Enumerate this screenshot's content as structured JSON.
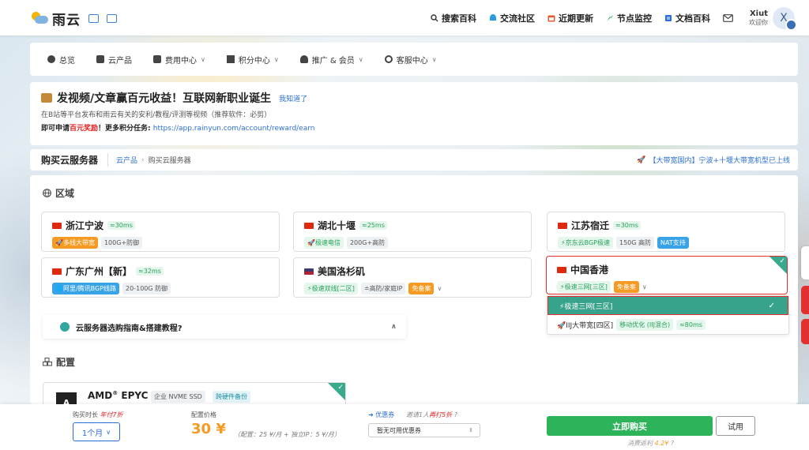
{
  "brand": {
    "name": "雨云"
  },
  "topnav": {
    "items": [
      {
        "label": "搜索百科",
        "icon": "search-icon"
      },
      {
        "label": "交流社区",
        "icon": "community-icon"
      },
      {
        "label": "近期更新",
        "icon": "calendar-icon"
      },
      {
        "label": "节点监控",
        "icon": "monitor-icon"
      },
      {
        "label": "文档百科",
        "icon": "docs-icon"
      }
    ],
    "mail_icon": "mail-icon",
    "user": {
      "name": "Xiut",
      "greeting": "欢迎你",
      "avatar_letter": "X"
    }
  },
  "subnav": {
    "items": [
      {
        "label": "总览",
        "icon": "dashboard-icon",
        "dropdown": false
      },
      {
        "label": "云产品",
        "icon": "cloud-products-icon",
        "dropdown": false
      },
      {
        "label": "费用中心",
        "icon": "billing-icon",
        "dropdown": true
      },
      {
        "label": "积分中心",
        "icon": "gift-icon",
        "dropdown": true
      },
      {
        "label": "推广 & 会员",
        "icon": "users-icon",
        "dropdown": true
      },
      {
        "label": "客服中心",
        "icon": "headset-icon",
        "dropdown": true
      }
    ]
  },
  "announcement": {
    "title": "发视频/文章赢百元收益！互联网新职业诞生",
    "dismiss": "我知道了",
    "line2": "在B站等平台发布和雨云有关的安利/教程/评测等视频（推荐软件：必剪）",
    "line3_prefix": "即可申请",
    "line3_reward": "百元奖励",
    "line3_mid": "！更多积分任务: ",
    "line3_link": "https://app.rainyun.com/account/reward/earn"
  },
  "breadcrumb": {
    "heading": "购买云服务器",
    "items": [
      "云产品",
      "购买云服务器"
    ],
    "notice": "【大带宽国内】宁波+十堰大带宽机型已上线"
  },
  "region": {
    "title": "区域",
    "cards": [
      {
        "name": "浙江宁波",
        "flag": "cn",
        "ping": "≈30ms",
        "tags": [
          {
            "text": "🚀多线大带宽",
            "style": "orange"
          },
          {
            "text": "100G+防御",
            "style": "gray"
          }
        ]
      },
      {
        "name": "湖北十堰",
        "flag": "cn",
        "ping": "≈25ms",
        "tags": [
          {
            "text": "🚀极速电信",
            "style": "green"
          },
          {
            "text": "200G+高防",
            "style": "gray"
          }
        ]
      },
      {
        "name": "江苏宿迁",
        "flag": "cn",
        "ping": "≈30ms",
        "tags": [
          {
            "text": "⚡京东云BGP极速",
            "style": "green"
          },
          {
            "text": "150G 高防",
            "style": "gray"
          },
          {
            "text": "NAT支持",
            "style": "blue"
          }
        ]
      },
      {
        "name": "广东广州【新】",
        "flag": "cn",
        "ping": "≈32ms",
        "tags": [
          {
            "text": "🌐阿里/腾讯BGP线路",
            "style": "blue"
          },
          {
            "text": "20-100G 防御",
            "style": "gray"
          }
        ]
      },
      {
        "name": "美国洛杉矶",
        "flag": "us",
        "ping": "",
        "tags": [
          {
            "text": "⚡极速双线[二区]",
            "style": "green"
          },
          {
            "text": "≐高防/家庭IP",
            "style": "gray"
          },
          {
            "text": "免备案",
            "style": "orange"
          }
        ]
      },
      {
        "name": "中国香港",
        "flag": "hk",
        "ping": "",
        "tags": [
          {
            "text": "⚡极速三网[三区]",
            "style": "green"
          },
          {
            "text": "免备案",
            "style": "orange"
          }
        ]
      }
    ],
    "dropdown": [
      {
        "label": "⚡极速三网[三区]",
        "selected": true
      },
      {
        "label": "🚀IIJ大带宽[四区]",
        "tags": [
          {
            "text": "移动优化 (IIJ混合)",
            "style": "green"
          },
          {
            "text": "≈80ms",
            "style": "green"
          }
        ]
      }
    ],
    "guide": "云服务器选购指南&搭建教程?"
  },
  "config": {
    "title": "配置",
    "cpu": {
      "logo": "A",
      "name": "AMD",
      "mark": "®",
      "model": " EPYC",
      "tags": [
        "企业 NVME SSD",
        "跨硬件备份"
      ]
    }
  },
  "bottom": {
    "duration_label": "购买时长",
    "duration_promo": "年付7折",
    "duration_value": "1个月",
    "price_label": "配置价格",
    "price": "30 ¥",
    "price_detail": "（配置：25 ¥/月 + 独立IP：5 ¥/月）",
    "coupon_label": "优惠券",
    "coupon_note_prefix": "邀请1人",
    "coupon_note_red": "再打5折",
    "coupon_select": "暂无可用优惠券",
    "buy": "立即购买",
    "trial": "试用",
    "rebate_prefix": "消费返利 ",
    "rebate_value": "4.2¥"
  },
  "colors": {
    "accent": "#2b6fd6",
    "buy_green": "#2db45a",
    "selected_teal": "#37a38a",
    "warn_red": "#e03030",
    "orange": "#f59a23"
  }
}
